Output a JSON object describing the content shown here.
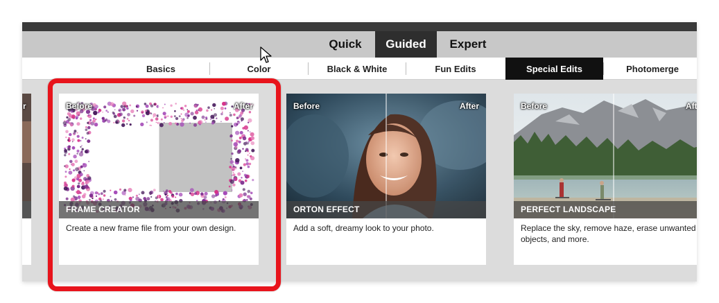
{
  "mode_tabs": [
    {
      "label": "Quick",
      "active": false
    },
    {
      "label": "Guided",
      "active": true
    },
    {
      "label": "Expert",
      "active": false
    }
  ],
  "sub_tabs": [
    {
      "label": "Basics",
      "active": false
    },
    {
      "label": "Color",
      "active": false
    },
    {
      "label": "Black & White",
      "active": false
    },
    {
      "label": "Fun Edits",
      "active": false
    },
    {
      "label": "Special Edits",
      "active": true
    },
    {
      "label": "Photomerge",
      "active": false
    }
  ],
  "cards": [
    {
      "title": "FRAME CREATOR",
      "description": "Create a new frame file from your own design.",
      "before_label": "Before",
      "after_label": "After",
      "highlighted": true
    },
    {
      "title": "ORTON EFFECT",
      "description": "Add a soft, dreamy look to your photo.",
      "before_label": "Before",
      "after_label": "After",
      "highlighted": false
    },
    {
      "title": "PERFECT LANDSCAPE",
      "description": "Replace the sky, remove haze, erase unwanted objects, and more.",
      "before_label": "Before",
      "after_label": "Aft",
      "highlighted": false
    }
  ],
  "partial_card_left": {
    "after_label_fragment": "r"
  },
  "colors": {
    "highlight": "#e8141c",
    "active_mode_tab": "#2e2e2e",
    "active_sub_tab": "#111111",
    "frame_purple": "#7b2a8c",
    "frame_pink": "#d6338a"
  },
  "icons": {
    "cursor": "mouse-pointer-icon"
  }
}
